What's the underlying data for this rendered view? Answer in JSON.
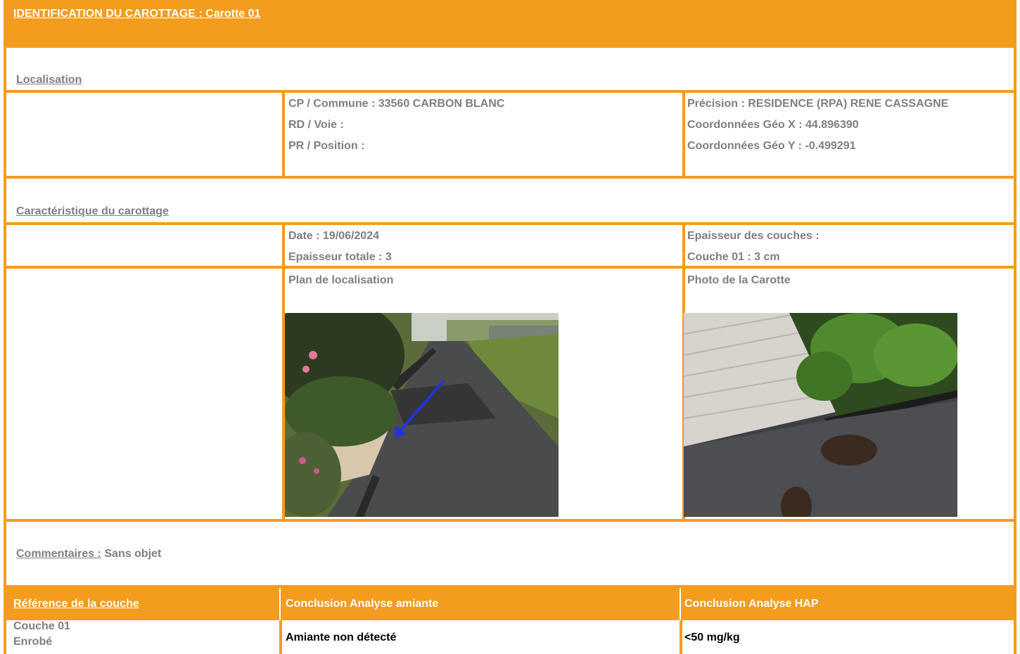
{
  "title": "IDENTIFICATION DU CAROTTAGE : Carotte 01",
  "localisation": {
    "heading": "Localisation",
    "cp_commune": "CP / Commune : 33560 CARBON BLANC",
    "rd_voie": "RD / Voie :",
    "pr_position": "PR / Position :",
    "precision": "Précision :  RESIDENCE (RPA) RENE CASSAGNE",
    "coord_x": "Coordonnées Géo X : 44.896390",
    "coord_y": "Coordonnées Géo Y : -0.499291"
  },
  "caracteristique": {
    "heading": "Caractéristique du carottage",
    "date": "Date : 19/06/2024",
    "epaisseur_totale": "Epaisseur totale : 3",
    "epaisseur_couches": "Epaisseur des couches :",
    "couche_01": "Couche 01 : 3 cm",
    "plan_label": "Plan de localisation",
    "photo_label": "Photo de la Carotte"
  },
  "commentaires": {
    "label": "Commentaires :",
    "value": "Sans objet"
  },
  "results": {
    "headers": [
      "Référence de la couche",
      "Conclusion Analyse amiante",
      "Conclusion Analyse HAP"
    ],
    "rows": [
      {
        "reference_line1": "Couche 01",
        "reference_line2": "Enrobé",
        "amiante": "Amiante non détecté",
        "hap": "<50 mg/kg"
      }
    ]
  },
  "colors": {
    "accent": "#f39c1d",
    "text": "#7f7f7f",
    "header_text": "#ffffff"
  }
}
